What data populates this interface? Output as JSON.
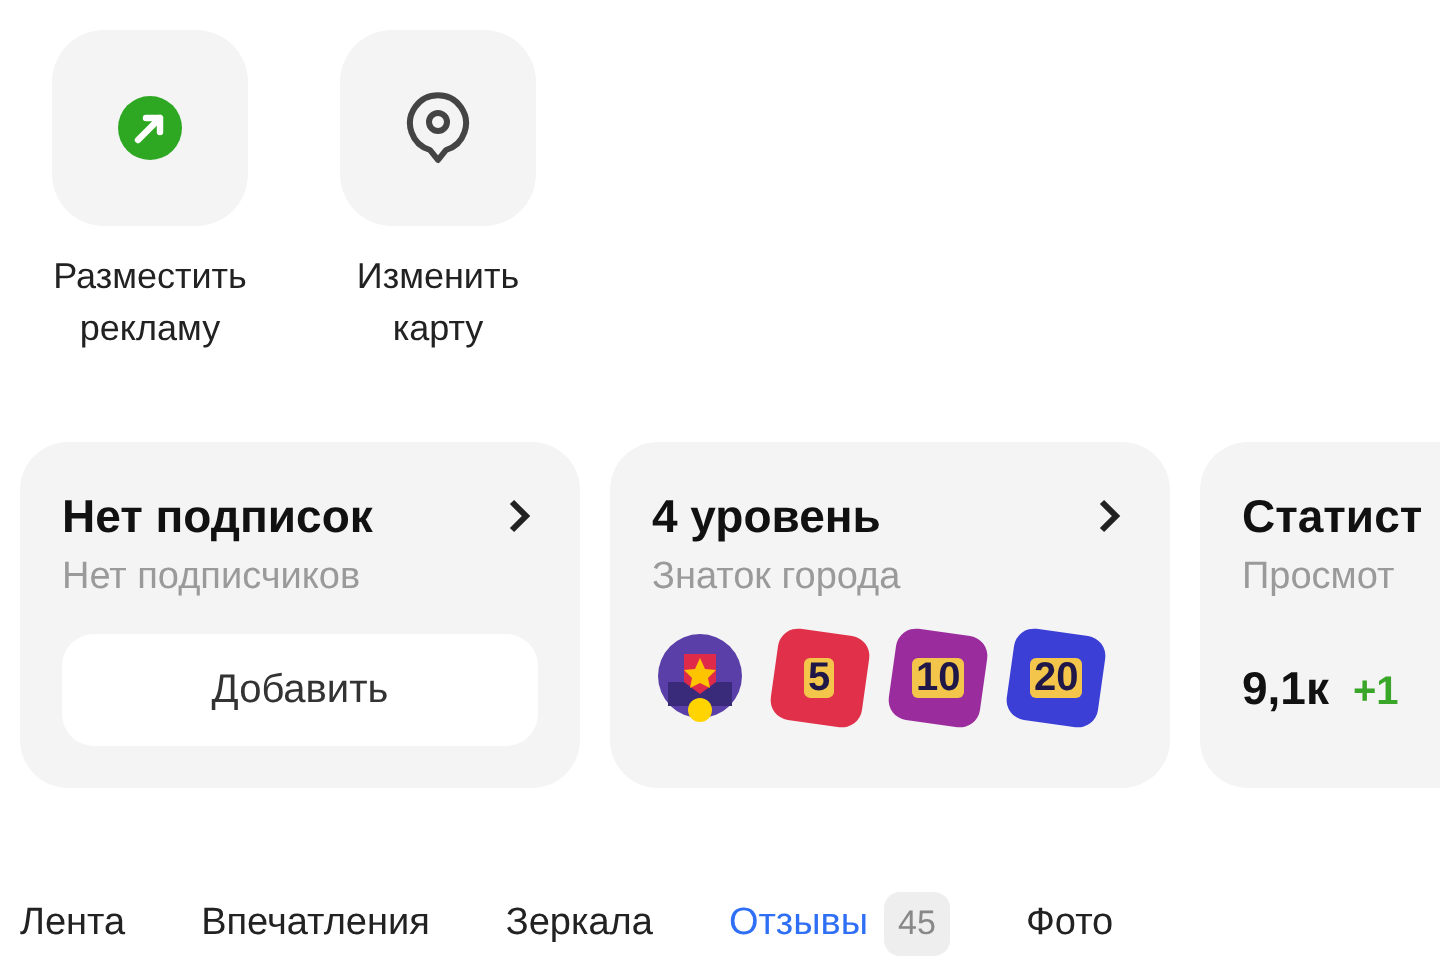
{
  "actions": [
    {
      "kind": "ad",
      "label": "Разместить\nрекламу"
    },
    {
      "kind": "map",
      "label": "Изменить\nкарту"
    }
  ],
  "cards": [
    {
      "kind": "subscriptions",
      "title": "Нет подписок",
      "subtitle": "Нет подписчиков",
      "button": "Добавить"
    },
    {
      "kind": "level",
      "title": "4 уровень",
      "subtitle": "Знаток города",
      "badges": [
        {
          "kind": "city"
        },
        {
          "kind": "number",
          "label": "5",
          "color": "#e0304a"
        },
        {
          "kind": "number",
          "label": "10",
          "color": "#9b2c9e"
        },
        {
          "kind": "number",
          "label": "20",
          "color": "#3b3fd6"
        }
      ]
    },
    {
      "kind": "stats",
      "title": "Статист",
      "subtitle": "Просмот",
      "value": "9,1к",
      "delta": "+1"
    }
  ],
  "tabs": [
    {
      "label": "Лента",
      "selected": false
    },
    {
      "label": "Впечатления",
      "selected": false
    },
    {
      "label": "Зеркала",
      "selected": false
    },
    {
      "label": "Отзывы",
      "selected": true,
      "count": "45"
    },
    {
      "label": "Фото",
      "selected": false
    }
  ]
}
